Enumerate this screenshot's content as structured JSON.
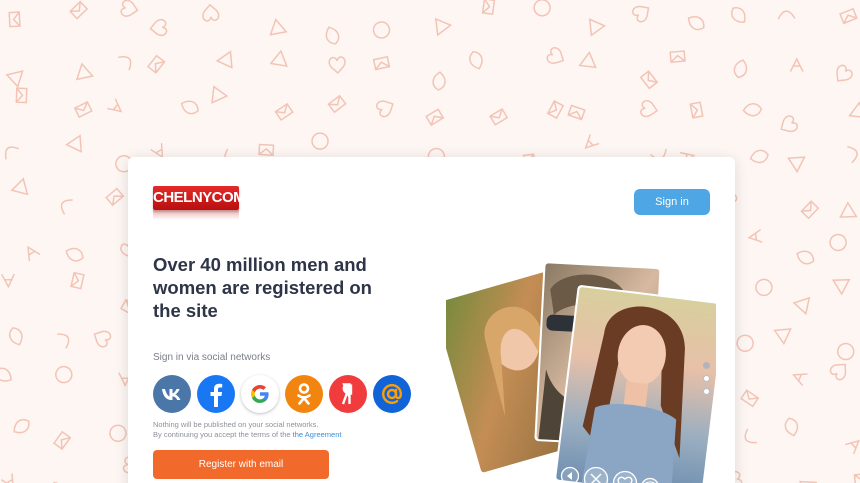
{
  "logo": {
    "text": "CHELNYCOM"
  },
  "header": {
    "signin_label": "Sign in"
  },
  "main": {
    "headline": "Over 40 million men and women are registered on the site",
    "social_label": "Sign in via social networks",
    "social_buttons": [
      {
        "name": "vk",
        "icon": "vk-icon",
        "color": "#4a76a8"
      },
      {
        "name": "facebook",
        "icon": "facebook-icon",
        "color": "#1877f2"
      },
      {
        "name": "google",
        "icon": "google-icon",
        "color": "#ffffff"
      },
      {
        "name": "odnoklassniki",
        "icon": "ok-icon",
        "color": "#f2850f"
      },
      {
        "name": "yandex",
        "icon": "yandex-icon",
        "color": "#f03c3c"
      },
      {
        "name": "mailru",
        "icon": "mail-at-icon",
        "color": "#1064d8"
      }
    ],
    "disclaimer_line1": "Nothing will be published on your social networks.",
    "disclaimer_line2": "By continuing you accept the terms of the",
    "agreement_link": "the Agreement",
    "register_label": "Register with email"
  },
  "slider": {
    "active_index": 0,
    "count": 3
  },
  "colors": {
    "accent": "#4fa6e4",
    "register": "#f26a2b",
    "headline": "#2e3547",
    "pattern": "#f3c2b4"
  }
}
